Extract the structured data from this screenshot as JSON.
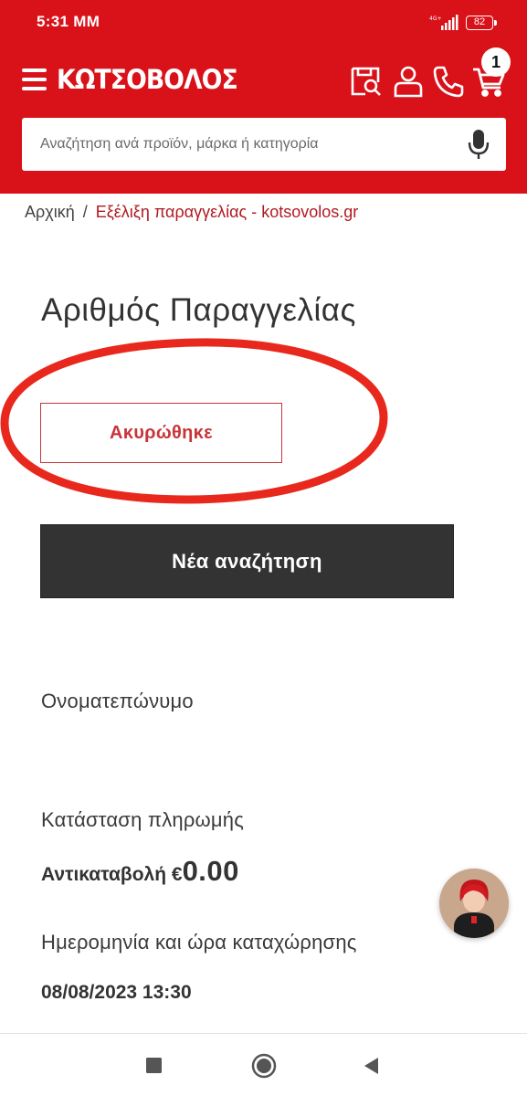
{
  "status_bar": {
    "time": "5:31 MM",
    "network": "4G+",
    "battery": "82"
  },
  "header": {
    "logo": "ΚΩΤΣΟΒΟΛΟΣ",
    "cart_count": "1",
    "icons": [
      "menu-icon",
      "store-search-icon",
      "user-icon",
      "phone-icon",
      "cart-icon"
    ],
    "brand_color": "#d9121a"
  },
  "search": {
    "placeholder": "Αναζήτηση ανά προϊόν, μάρκα ή κατηγορία"
  },
  "breadcrumb": {
    "home": "Αρχική",
    "separator": "/",
    "current": "Εξέλιξη παραγγελίας - kotsovolos.gr"
  },
  "order": {
    "title": "Αριθμός Παραγγελίας",
    "status": "Ακυρώθηκε",
    "new_search_label": "Νέα αναζήτηση",
    "name_label": "Ονοματεπώνυμο",
    "payment_label": "Κατάσταση πληρωμής",
    "payment_method": "Αντικαταβολή €",
    "payment_amount": "0.00",
    "date_label": "Ημερομηνία και ώρα καταχώρησης",
    "date_value": "08/08/2023 13:30"
  }
}
